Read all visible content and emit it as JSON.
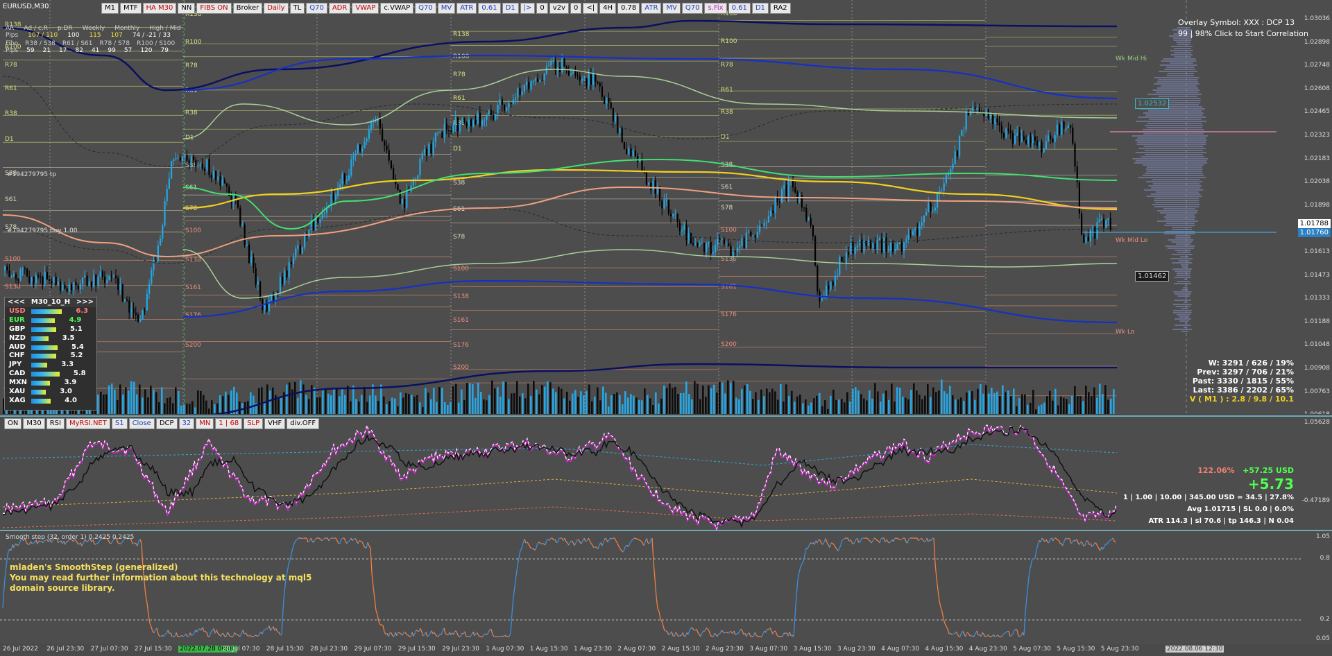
{
  "symbol_title": "EURUSD,M30",
  "top_toolbar": [
    "M1",
    "MTF",
    "HA M30",
    "NN",
    "FIBS ON",
    "Broker",
    "Daily",
    "TL",
    "Q70",
    "ADR",
    "VWAP",
    "c.VWAP",
    "Q70",
    "MV",
    "ATR",
    "0.61",
    "D1",
    "|>",
    "0",
    "v2v",
    "0",
    "<|",
    "4H",
    "0.78",
    "ATR",
    "MV",
    "Q70",
    "s.Fix",
    "0.61",
    "D1",
    "RA2"
  ],
  "toolbar_colors": {
    "HA M30": "#c00000",
    "FIBS ON": "#c00000",
    "ADR": "#c00000",
    "VWAP": "#c00000",
    "Daily": "#c00000",
    "Q70": "#1a3fbf",
    "MV": "#1a3fbf",
    "ATR": "#1a3fbf",
    "0.61": "#1a3fbf",
    "D1": "#1a3fbf",
    "|>": "#1a3fbf",
    "s.Fix": "#c020c0",
    "RA2": "#000"
  },
  "ranges_panel": {
    "headers": [
      "AR",
      "Ad / c.R",
      "p.DR",
      "Weekly",
      "Monthly",
      "High / Mid"
    ],
    "pips_label": "Pips",
    "pips_values": [
      "107 / 110",
      "100",
      "115",
      "107",
      "74 / -21 / 33"
    ],
    "fibo_label": "Fibo",
    "fibo_headers": [
      "R38 / S38",
      "R61 / S61",
      "R78 / S78",
      "R100 / S100"
    ],
    "fibo_pips_values": [
      "59",
      "21",
      "17",
      "82",
      "41",
      "99",
      "57",
      "120",
      "79"
    ]
  },
  "trade_labels": [
    "#194279795 tp",
    "#194279795 buy 1.00"
  ],
  "overlay": {
    "line1": "Overlay Symbol: XXX : DCP 13",
    "line2": "99 | 98% Click to Start Correlation"
  },
  "price_axis": [
    "1.03036",
    "1.02898",
    "1.02748",
    "1.02608",
    "1.02465",
    "1.02323",
    "1.02183",
    "1.02038",
    "1.01898",
    "1.01753",
    "1.01613",
    "1.01473",
    "1.01333",
    "1.01188",
    "1.01048",
    "1.00908",
    "1.00763",
    "1.00618"
  ],
  "price_boxes": {
    "current": "1.01788",
    "current2": "1.01760",
    "level_a": "1.02532",
    "level_b": "1.01462"
  },
  "level_labels": {
    "wk_mid_hi": "Wk Mid Hi",
    "wk_mid_lo": "Wk Mid Lo",
    "wk_lo": "Wk Lo"
  },
  "fib_labels": [
    "R138",
    "R100",
    "R78",
    "R61",
    "R38",
    "D1",
    "S38",
    "S61",
    "S78",
    "S100",
    "S138",
    "S161",
    "S176",
    "S200"
  ],
  "strength": {
    "header": [
      "<<<",
      "M30_10_H",
      ">>>"
    ],
    "rows": [
      {
        "ccy": "USD",
        "val": "6.3",
        "color": "#ff7b7b"
      },
      {
        "ccy": "EUR",
        "val": "4.9",
        "color": "#4cff4c"
      },
      {
        "ccy": "GBP",
        "val": "5.1",
        "color": "#ffffff"
      },
      {
        "ccy": "NZD",
        "val": "3.5",
        "color": "#ffffff"
      },
      {
        "ccy": "AUD",
        "val": "5.4",
        "color": "#ffffff"
      },
      {
        "ccy": "CHF",
        "val": "5.2",
        "color": "#ffffff"
      },
      {
        "ccy": "JPY",
        "val": "3.3",
        "color": "#ffffff"
      },
      {
        "ccy": "CAD",
        "val": "5.8",
        "color": "#ffffff"
      },
      {
        "ccy": "MXN",
        "val": "3.9",
        "color": "#ffffff"
      },
      {
        "ccy": "XAU",
        "val": "3.0",
        "color": "#ffffff"
      },
      {
        "ccy": "XAG",
        "val": "4.0",
        "color": "#ffffff"
      }
    ]
  },
  "stats": {
    "w": "W: 3291 / 626 / 19%",
    "prev": "Prev: 3297 / 706 / 21%",
    "past": "Past: 3330 / 1815 / 55%",
    "last": "Last: 3386 / 2202 / 65%",
    "v": "V ( M1 ) : 2.8 / 9.8 / 10.1"
  },
  "osc1_toolbar": [
    "ON",
    "M30",
    "RSI",
    "MyRSI.NET",
    "S1",
    "Close",
    "DCP",
    "32",
    "MN",
    "1 | 68",
    "SLP",
    "VHF",
    "div.OFF"
  ],
  "osc1_axis": [
    "1.05628",
    "-0.47189"
  ],
  "trade_info": {
    "pct": "122.06%",
    "usd": "+57.25 USD",
    "big": "+5.73",
    "row1": "1  |  1.00  |  10.00  |  345.00 USD = 34.5  |  27.8%",
    "row2": "Avg 1.01715  |  SL 0.0  |  0.0%",
    "row3": "ATR 114.3  |  sl 70.6  |  tp 146.3  |  N 0.04"
  },
  "osc2_title": "Smooth step (32, order 1) 0.2425 0.2425",
  "osc2_text": [
    "mladen's SmoothStep (generalized)",
    "You may read further information about this technology at mql5",
    "domain source library."
  ],
  "osc2_axis": [
    "1.05",
    "0.8",
    "0.2",
    "0.05"
  ],
  "time_axis": [
    "26 Jul 2022",
    "26 Jul 23:30",
    "27 Jul 07:30",
    "27 Jul 15:30",
    "2022.07.28 00:00",
    "28 Jul 07:30",
    "28 Jul 15:30",
    "28 Jul 23:30",
    "29 Jul 07:30",
    "29 Jul 15:30",
    "29 Jul 23:30",
    "1 Aug 07:30",
    "1 Aug 15:30",
    "1 Aug 23:30",
    "2 Aug 07:30",
    "2 Aug 15:30",
    "2 Aug 23:30",
    "3 Aug 07:30",
    "3 Aug 15:30",
    "3 Aug 23:30",
    "4 Aug 07:30",
    "4 Aug 15:30",
    "4 Aug 23:30",
    "5 Aug 07:30",
    "5 Aug 15:30",
    "5 Aug 23:30",
    "2022.08.06 12:30"
  ],
  "colors": {
    "candle_up": "#22a8e8",
    "candle_down": "#000000",
    "bg": "#4d4d4d",
    "upper_band": "#0a1060",
    "mid_blue": "#1530c8",
    "yellow": "#f0d020",
    "green": "#40e070",
    "salmon": "#f0a080"
  }
}
